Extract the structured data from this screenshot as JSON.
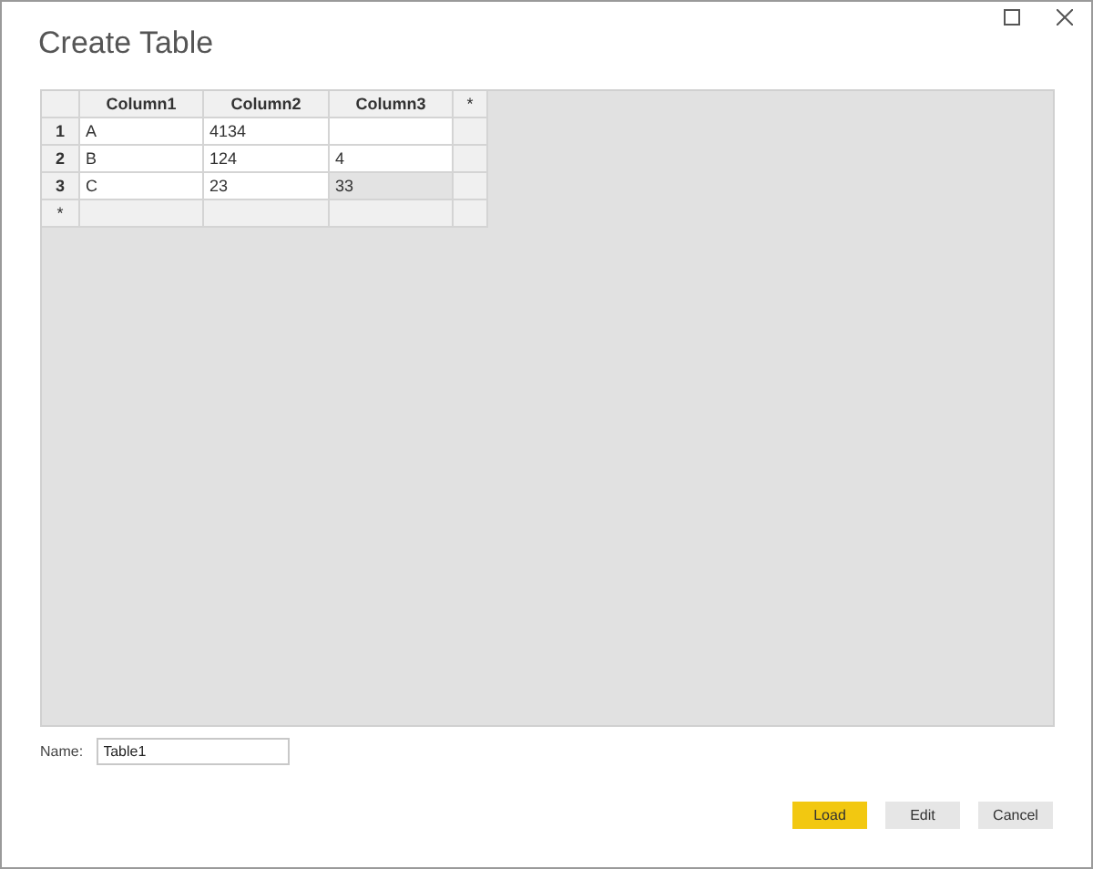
{
  "window": {
    "title": "Create Table"
  },
  "table": {
    "columns": [
      "Column1",
      "Column2",
      "Column3"
    ],
    "add_column": "*",
    "new_row": "*",
    "rows": [
      {
        "number": "1",
        "cells": [
          {
            "text": "A",
            "selected": false
          },
          {
            "text": "4134",
            "selected": false
          },
          {
            "selected": false
          }
        ]
      },
      {
        "number": "2",
        "cells": [
          {
            "text": "B",
            "selected": false
          },
          {
            "text": "124",
            "selected": false
          },
          {
            "text": "4",
            "selected": false
          }
        ]
      },
      {
        "number": "3",
        "cells": [
          {
            "text": "C",
            "selected": false
          },
          {
            "text": "23",
            "selected": false
          },
          {
            "text": "33",
            "selected": true
          }
        ]
      }
    ]
  },
  "name_field": {
    "label": "Name:",
    "value": "Table1"
  },
  "buttons": [
    {
      "label": "Load",
      "kind": "primary"
    },
    {
      "label": "Edit",
      "kind": "secondary"
    },
    {
      "label": "Cancel",
      "kind": "secondary"
    }
  ]
}
